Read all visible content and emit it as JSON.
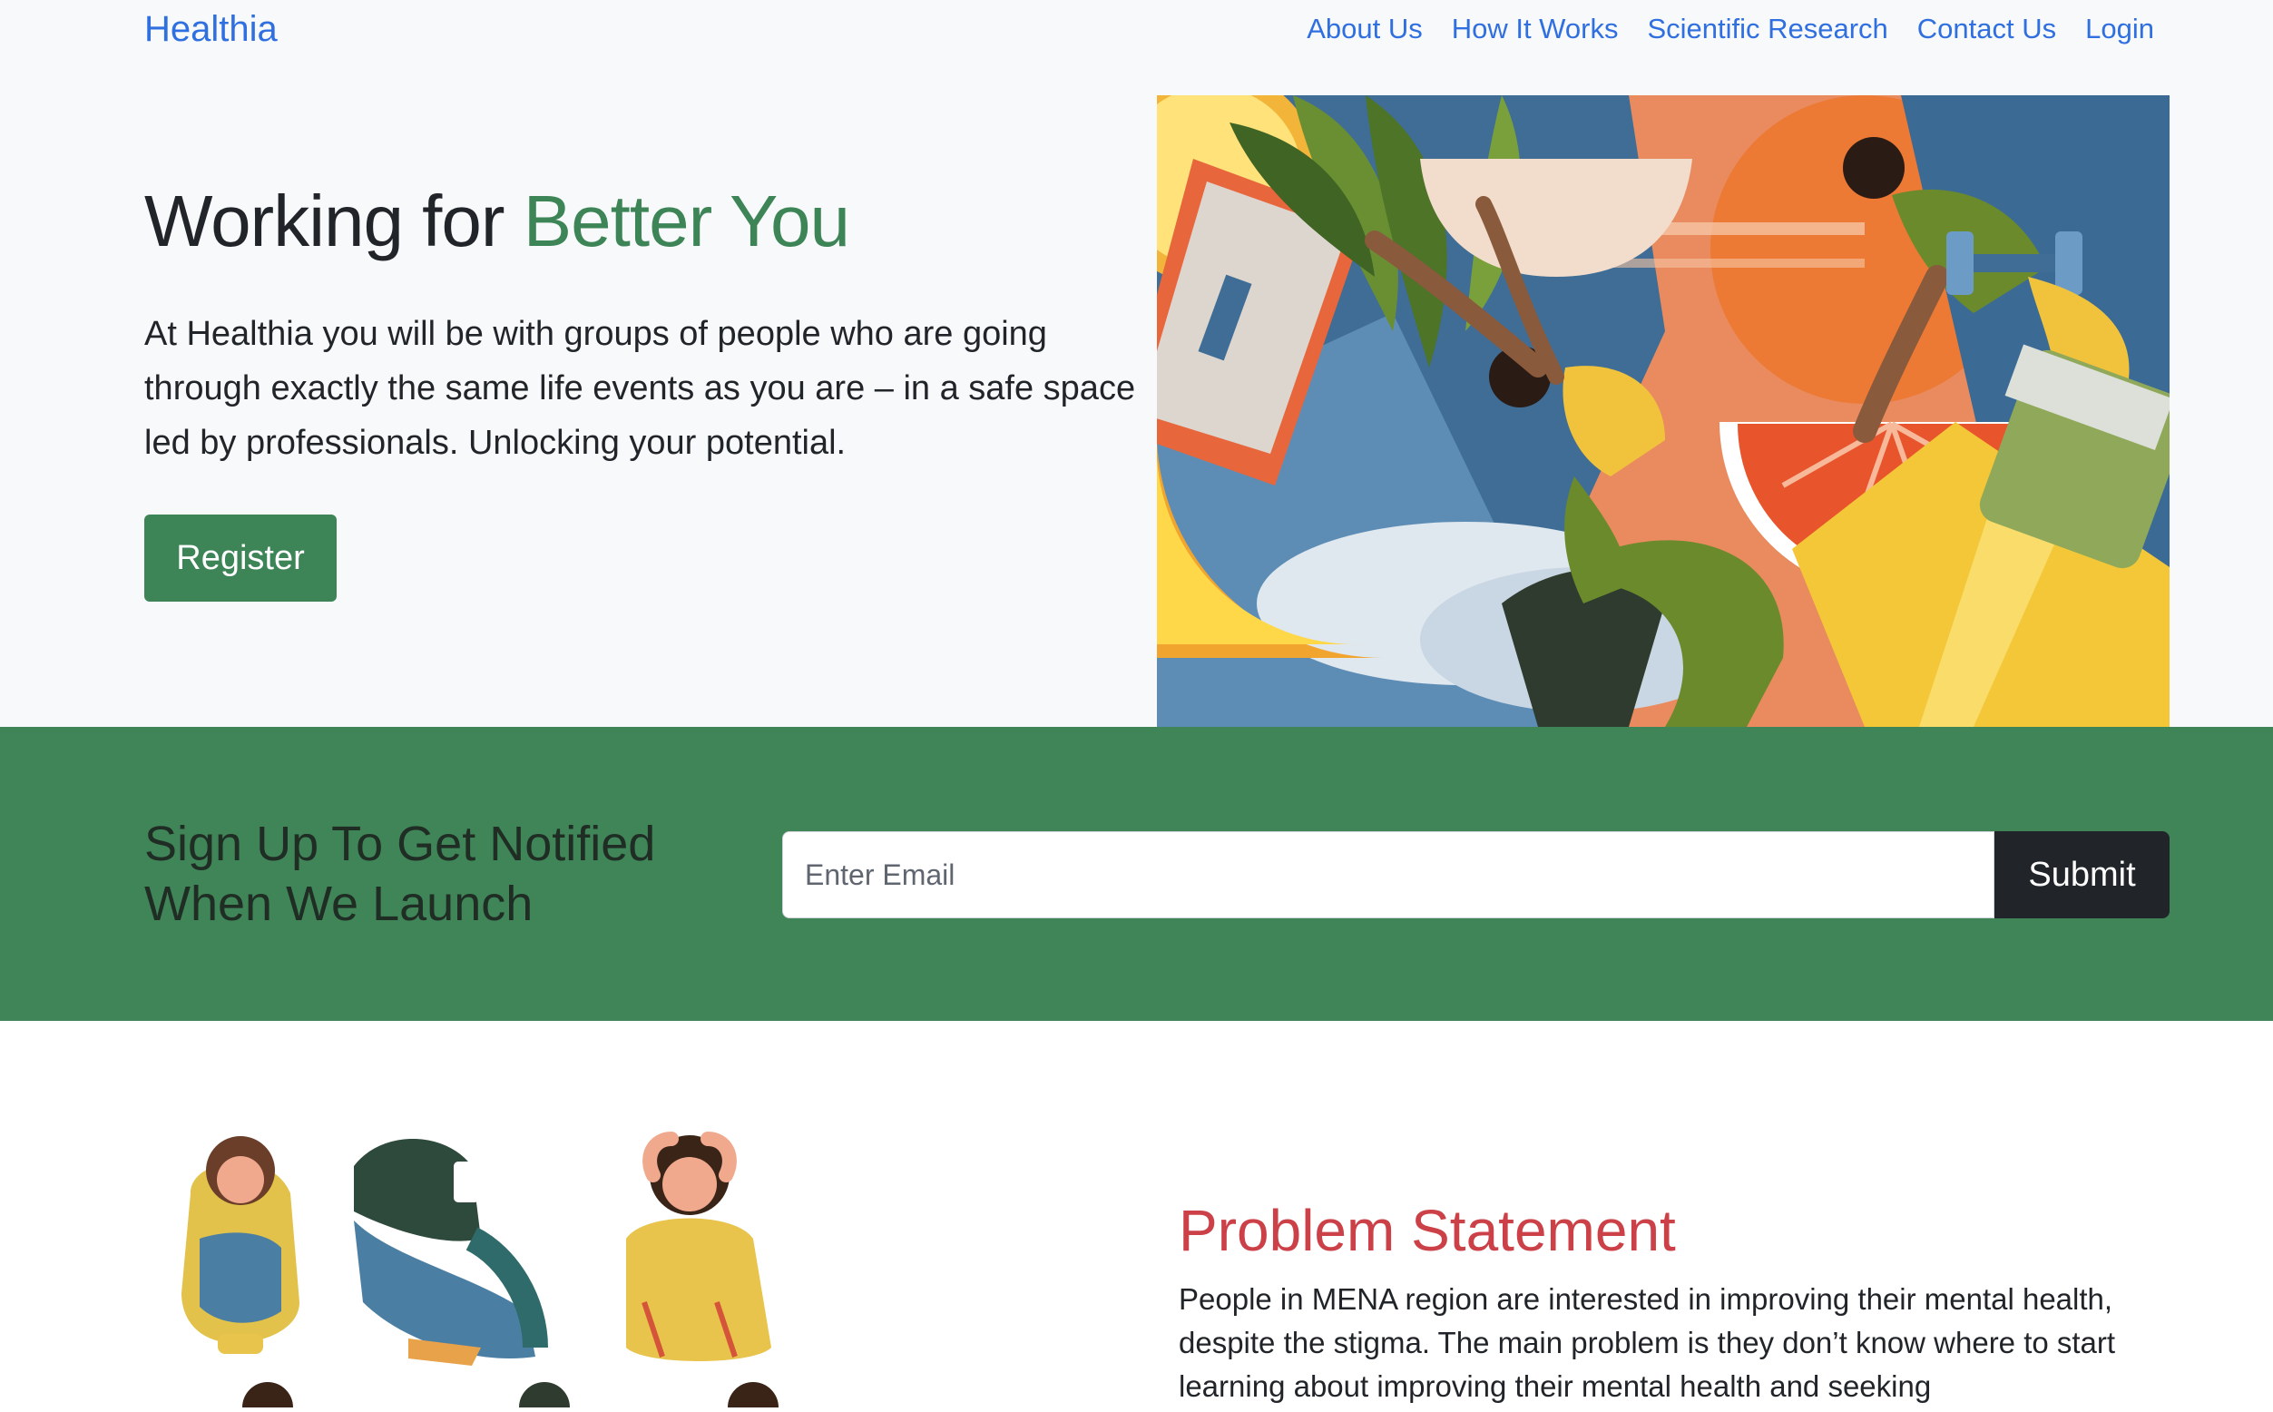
{
  "navbar": {
    "brand": "Healthia",
    "links": [
      {
        "label": "About Us"
      },
      {
        "label": "How It Works"
      },
      {
        "label": "Scientific Research"
      },
      {
        "label": "Contact Us"
      },
      {
        "label": "Login"
      }
    ]
  },
  "hero": {
    "title_prefix": "Working for ",
    "title_accent": "Better You",
    "description": "At Healthia you will be with groups of people who are going through exactly the same life events as you are – in a safe space led by professionals. Unlocking your potential.",
    "register_label": "Register",
    "illustration_icon": "fitness-illustration"
  },
  "signup": {
    "title": "Sign Up To Get Notified When We Launch",
    "email_placeholder": "Enter Email",
    "email_value": "",
    "submit_label": "Submit"
  },
  "problem": {
    "title": "Problem Statement",
    "text": "People in MENA region are interested in improving their mental health, despite the stigma. The main problem is they don’t know where to start learning about improving their mental health and seeking",
    "illustration_icon": "distressed-people-illustration"
  },
  "colors": {
    "brand_link": "#2f6fe0",
    "accent_green": "#3d8557",
    "band_green": "#408558",
    "problem_red": "#cc4148",
    "submit_dark": "#212529"
  }
}
